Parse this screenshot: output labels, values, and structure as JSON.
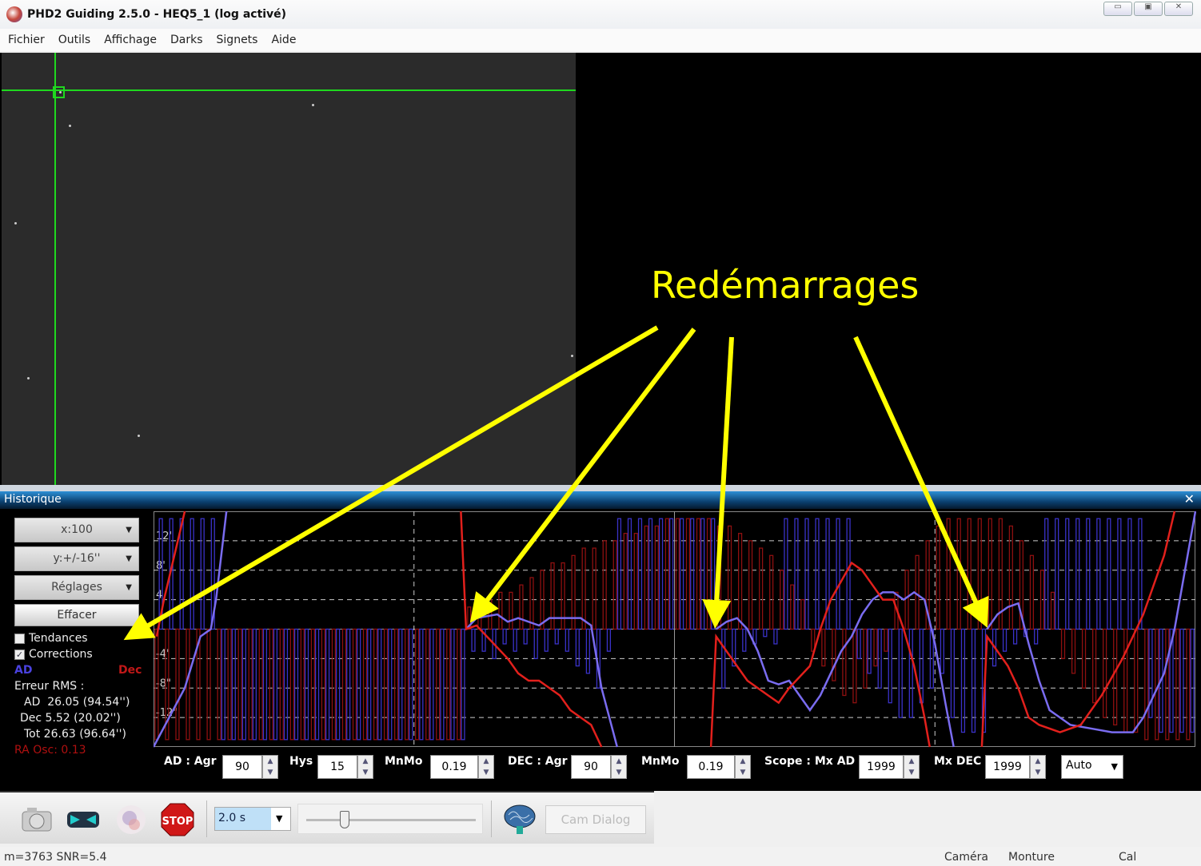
{
  "window": {
    "title": "PHD2 Guiding 2.5.0 - HEQ5_1 (log activé)",
    "buttons": [
      "▭",
      "▣",
      "✕"
    ]
  },
  "menu": [
    "Fichier",
    "Outils",
    "Affichage",
    "Darks",
    "Signets",
    "Aide"
  ],
  "history": {
    "title": "Historique",
    "close": "✕",
    "x_scale": "x:100",
    "y_scale": "y:+/-16''",
    "settings": "Réglages",
    "clear": "Effacer",
    "trends": {
      "label": "Tendances",
      "checked": false
    },
    "corrections": {
      "label": "Corrections",
      "checked": true
    },
    "legend_ra": "AD",
    "legend_dec": "Dec",
    "rms_title": "Erreur RMS :",
    "rms_ra": "AD  26.05 (94.54'')",
    "rms_dec": "Dec 5.52 (20.02'')",
    "rms_tot": "Tot 26.63 (96.64'')",
    "ra_osc": "RA Osc: 0.13",
    "colors": {
      "ra": "#7a6cf0",
      "dec": "#e2201c",
      "ra_bar": "#3a32c8",
      "dec_bar": "#8e1010"
    }
  },
  "params": {
    "ad_agr_label": "AD : Agr",
    "ad_agr": "90",
    "hys_label": "Hys",
    "hys": "15",
    "mnmo_label": "MnMo",
    "mnmo_ad": "0.19",
    "dec_agr_label": "DEC : Agr",
    "dec_agr": "90",
    "mnmo2_label": "MnMo",
    "mnmo_dec": "0.19",
    "mxad_label": "Scope : Mx AD",
    "mxad": "1999",
    "mxdec_label": "Mx DEC",
    "mxdec": "1999",
    "dec_mode": "Auto"
  },
  "toolbar": {
    "exposure": "2.0 s",
    "cam_dialog": "Cam Dialog",
    "stop": "STOP",
    "exposure_slider": 0.2
  },
  "status": {
    "left": "m=3763 SNR=5.4",
    "camera": "Caméra",
    "mount": "Monture",
    "cal": "Cal"
  },
  "annotation": "Redémarrages",
  "chart_data": {
    "type": "line",
    "xlim": [
      0,
      100
    ],
    "ylim": [
      -16,
      16
    ],
    "y_ticks": [
      "12'",
      "8'",
      "4",
      "-4'",
      "-8\"",
      "-12\""
    ],
    "y_tick_values": [
      12,
      8,
      4,
      -4,
      -8,
      -12
    ],
    "restarts_at": [
      30,
      54,
      80
    ],
    "series": [
      {
        "name": "AD",
        "segments": [
          [
            [
              0,
              -16
            ],
            [
              3,
              -8
            ],
            [
              4.5,
              -1
            ],
            [
              5.5,
              0
            ],
            [
              6,
              4
            ],
            [
              6.5,
              10
            ],
            [
              7,
              16
            ]
          ],
          [
            [
              30,
              0
            ],
            [
              31,
              1.5
            ],
            [
              33,
              2
            ],
            [
              34,
              1
            ],
            [
              35,
              1.5
            ],
            [
              37,
              0.5
            ],
            [
              38,
              1.5
            ],
            [
              41,
              1.5
            ],
            [
              42,
              0.5
            ],
            [
              43,
              -8
            ],
            [
              44.5,
              -16
            ]
          ],
          [
            [
              54,
              0
            ],
            [
              55,
              1
            ],
            [
              56,
              1.5
            ],
            [
              57,
              0
            ],
            [
              58,
              -3
            ],
            [
              59,
              -7
            ],
            [
              60,
              -7.5
            ],
            [
              61,
              -7
            ],
            [
              62,
              -9
            ],
            [
              63,
              -11
            ],
            [
              64,
              -9
            ],
            [
              65,
              -6
            ],
            [
              66,
              -3
            ],
            [
              67,
              -1
            ],
            [
              68,
              2
            ],
            [
              69,
              4
            ],
            [
              70,
              5
            ],
            [
              71,
              5
            ],
            [
              72,
              4
            ],
            [
              73,
              5
            ],
            [
              74,
              4
            ],
            [
              75,
              -2
            ],
            [
              76,
              -10
            ],
            [
              76.8,
              -16
            ]
          ],
          [
            [
              80,
              0
            ],
            [
              81,
              2
            ],
            [
              82,
              3
            ],
            [
              83,
              3.5
            ],
            [
              84,
              -2
            ],
            [
              85,
              -7
            ],
            [
              86,
              -11
            ],
            [
              87,
              -12
            ],
            [
              88,
              -13
            ],
            [
              90,
              -13.5
            ],
            [
              92,
              -14
            ],
            [
              94,
              -14
            ],
            [
              95,
              -12
            ],
            [
              97,
              -6
            ],
            [
              98,
              0
            ],
            [
              99,
              8
            ],
            [
              100,
              16
            ]
          ]
        ]
      },
      {
        "name": "Dec",
        "segments": [
          [
            [
              0.3,
              -1
            ],
            [
              1,
              4
            ],
            [
              2,
              10
            ],
            [
              3,
              16
            ]
          ],
          [
            [
              29.5,
              16
            ],
            [
              30,
              0
            ],
            [
              31,
              0.5
            ],
            [
              32,
              -1
            ],
            [
              33,
              -2.5
            ],
            [
              34,
              -4
            ],
            [
              35,
              -6
            ],
            [
              36,
              -7
            ],
            [
              37,
              -7
            ],
            [
              38,
              -8
            ],
            [
              39,
              -9
            ],
            [
              40,
              -11
            ],
            [
              41,
              -12
            ],
            [
              42,
              -13
            ],
            [
              43,
              -16
            ]
          ],
          [
            [
              53.5,
              -16
            ],
            [
              54,
              -1
            ],
            [
              55,
              -3
            ],
            [
              56,
              -5
            ],
            [
              57,
              -7
            ],
            [
              58,
              -8
            ],
            [
              59,
              -9
            ],
            [
              60,
              -10
            ],
            [
              61,
              -8
            ],
            [
              63,
              -5
            ],
            [
              64,
              0
            ],
            [
              65,
              4
            ],
            [
              67,
              9
            ],
            [
              68,
              8
            ],
            [
              69,
              6
            ],
            [
              70,
              4
            ],
            [
              71,
              4
            ],
            [
              72,
              0
            ],
            [
              73,
              -5
            ],
            [
              74,
              -12
            ],
            [
              74.5,
              -16
            ]
          ],
          [
            [
              79.5,
              -16
            ],
            [
              80,
              -1
            ],
            [
              81,
              -3
            ],
            [
              82,
              -5
            ],
            [
              83,
              -8
            ],
            [
              84,
              -12
            ],
            [
              85,
              -13
            ],
            [
              87,
              -14
            ],
            [
              89,
              -13
            ],
            [
              91,
              -9
            ],
            [
              93,
              -4
            ],
            [
              95,
              2
            ],
            [
              97,
              10
            ],
            [
              98,
              16
            ]
          ]
        ]
      }
    ],
    "corrections_ra": [
      15,
      15,
      15,
      15,
      15,
      15,
      -15,
      -15,
      -15,
      -15,
      -15,
      -15,
      -15,
      -15,
      -15,
      -15,
      -15,
      -15,
      -15,
      -15,
      -15,
      -15,
      -15,
      -15,
      -15,
      -15,
      -15,
      -15,
      -15,
      -15,
      -3,
      -3,
      -4,
      -2,
      -3,
      -2,
      -4,
      -3,
      -2,
      -3,
      -5,
      -6,
      -8,
      -3,
      15,
      15,
      15,
      15,
      15,
      15,
      15,
      15,
      15,
      15,
      -8,
      -5,
      -3,
      -2,
      -1,
      -2,
      15,
      15,
      15,
      15,
      15,
      15,
      15,
      -4,
      -6,
      -8,
      -10,
      -12,
      -12,
      -10,
      -8,
      -6,
      -12,
      -14,
      -14,
      -14,
      -5,
      -3,
      -2,
      -1,
      -2,
      15,
      15,
      15,
      15,
      15,
      15,
      15,
      15,
      15,
      15,
      -12,
      -14,
      -14,
      -14,
      -14
    ],
    "corrections_dec": [
      -15,
      -15,
      -15,
      -15,
      -15,
      -15,
      -15,
      -15,
      -15,
      -15,
      -15,
      -15,
      -15,
      -15,
      -15,
      -15,
      -15,
      -15,
      -15,
      -15,
      -15,
      -15,
      -15,
      -15,
      -15,
      -15,
      -15,
      -15,
      -15,
      -15,
      3,
      3,
      4,
      5,
      5,
      6,
      7,
      8,
      9,
      9,
      10,
      11,
      11,
      12,
      12,
      13,
      13,
      14,
      14,
      15,
      15,
      15,
      15,
      15,
      14,
      14,
      13,
      12,
      11,
      10,
      8,
      6,
      4,
      -3,
      -5,
      -7,
      -9,
      -10,
      -8,
      -5,
      -3,
      5,
      8,
      10,
      12,
      14,
      15,
      15,
      15,
      15,
      15,
      15,
      14,
      12,
      10,
      8,
      5,
      -4,
      -6,
      -8,
      -10,
      -12,
      -13,
      -14,
      -14,
      -15,
      -15,
      -15,
      -15,
      -15
    ]
  }
}
